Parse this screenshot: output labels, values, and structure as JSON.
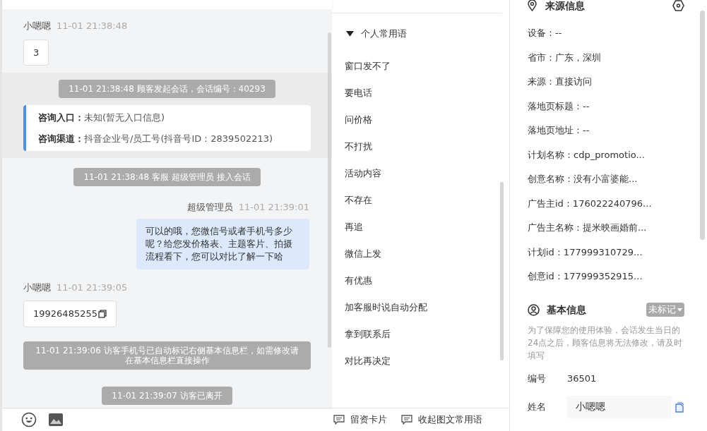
{
  "chat": {
    "messages": [
      {
        "kind": "visitor",
        "sender": "小嗯嗯",
        "time": "11-01 21:38:48",
        "text": "3",
        "copyable": false
      },
      {
        "kind": "session_start",
        "text": "11-01 21:38:48 顾客发起会话，会话编号：40293",
        "rows": [
          {
            "label": "咨询入口：",
            "value": "未知(暂无入口信息)"
          },
          {
            "label": "咨询渠道：",
            "value": "抖音企业号/员工号(抖音号ID：2839502213)"
          }
        ]
      },
      {
        "kind": "system",
        "text": "11-01 21:38:48 客服 超级管理员 接入会话"
      },
      {
        "kind": "agent",
        "sender": "超级管理员",
        "time": "11-01 21:39:01",
        "text": "可以的哦，您微信号或者手机号多少呢？给您发价格表、主题客片、拍摄流程看下，您可以对比了解一下哈"
      },
      {
        "kind": "visitor",
        "sender": "小嗯嗯",
        "time": "11-01 21:39:05",
        "text": "19926485255",
        "copyable": true
      },
      {
        "kind": "system",
        "text": "11-01 21:39:06 访客手机号已自动标记右侧基本信息栏，如需修改请在基本信息栏直接操作"
      },
      {
        "kind": "system",
        "text": "11-01 21:39:07 访客已离开"
      }
    ]
  },
  "quick_replies": {
    "group": {
      "title": "个人常用语",
      "expanded": true
    },
    "items": [
      "窗口发不了",
      "要电话",
      "问价格",
      "不打扰",
      "活动内容",
      "不存在",
      "再追",
      "微信上发",
      "有优惠",
      "加客服时说自动分配",
      "拿到联系后",
      "对比再决定"
    ],
    "footer": [
      "留资卡片",
      "收起图文常用语"
    ]
  },
  "source_info": {
    "title": "来源信息",
    "fields": [
      "设备：--",
      "省市：广东，深圳",
      "来源：直接访问",
      "落地页标题：--",
      "落地页地址：--",
      "计划名称：cdp_promotio...",
      "创意名称：没有小富婆能...",
      "广告主id：176022240796...",
      "广告主名称：提米映画婚前...",
      "计划id：177999310729...",
      "创意id：177999352915..."
    ]
  },
  "basic_info": {
    "title": "基本信息",
    "tag": "未标记",
    "notice": "为了保障您的使用体验，会话发生当日的24点之后，顾客信息将无法修改，请及时填写",
    "number_label": "编号",
    "number": "36501",
    "name_label": "姓名",
    "name": "小嗯嗯"
  }
}
